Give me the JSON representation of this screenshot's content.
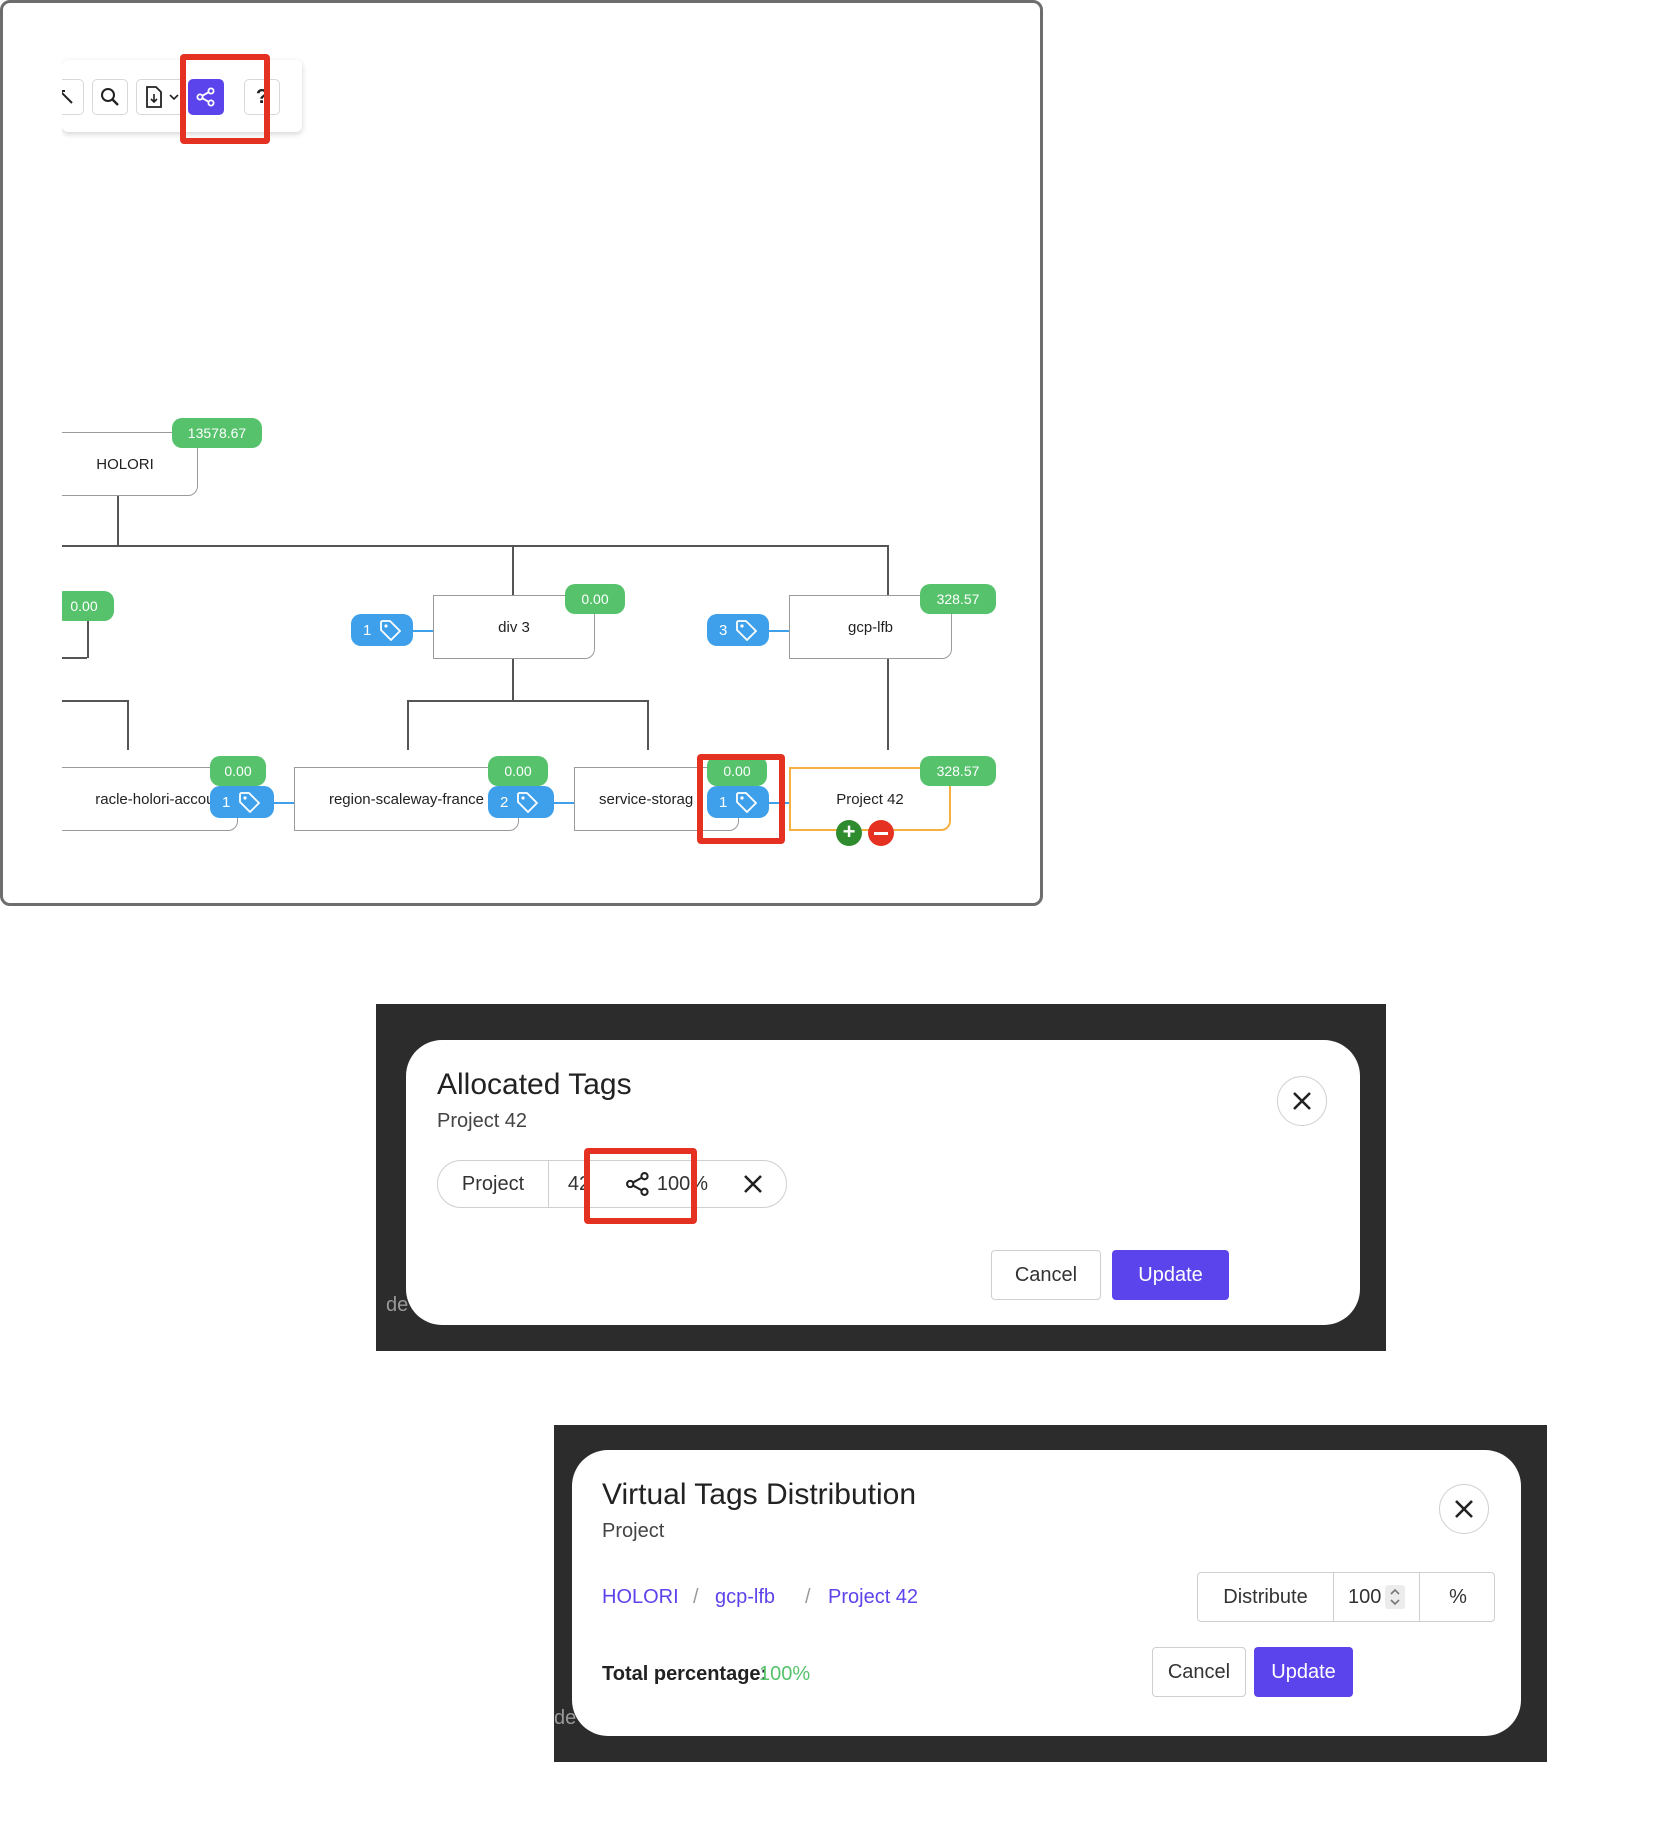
{
  "tree": {
    "toolbar": {
      "icons": [
        "expand-icon",
        "search-icon",
        "export-file-icon",
        "chevron-down-icon",
        "share-distribute-icon",
        "help-icon"
      ],
      "help_label": "?"
    },
    "nodes": {
      "holori": {
        "label": "HOLORI",
        "value": "13578.67"
      },
      "left_top": {
        "value": "0.00"
      },
      "div3": {
        "label": "div 3",
        "value": "0.00",
        "tags": "1"
      },
      "gcp": {
        "label": "gcp-lfb",
        "value": "328.57",
        "tags": "3"
      },
      "oracle": {
        "label": "racle-holori-account",
        "value": "0.00",
        "tags": "1"
      },
      "region": {
        "label": "region-scaleway-france",
        "value": "0.00",
        "tags": "2"
      },
      "service": {
        "label": "service-storag",
        "value": "0.00",
        "tags": "1"
      },
      "project": {
        "label": "Project 42",
        "value": "328.57"
      }
    },
    "colors": {
      "accent": "#5c44ec",
      "value_badge": "#56c26b",
      "tag_badge": "#3ea0ea",
      "highlight": "#e53122",
      "selected": "#f5b041"
    }
  },
  "allocated": {
    "title": "Allocated Tags",
    "subtitle": "Project 42",
    "chip": {
      "key": "Project",
      "value": "42",
      "percent": "100%"
    },
    "cancel": "Cancel",
    "update": "Update",
    "background_text": "de"
  },
  "distribution": {
    "title": "Virtual Tags Distribution",
    "subtitle": "Project",
    "breadcrumb": [
      "HOLORI",
      "gcp-lfb",
      "Project 42"
    ],
    "separator": "/",
    "distribute_label": "Distribute",
    "distribute_value": "100",
    "unit": "%",
    "total_label": "Total percentage:",
    "total_value": "100%",
    "cancel": "Cancel",
    "update": "Update",
    "background_text": "de"
  }
}
